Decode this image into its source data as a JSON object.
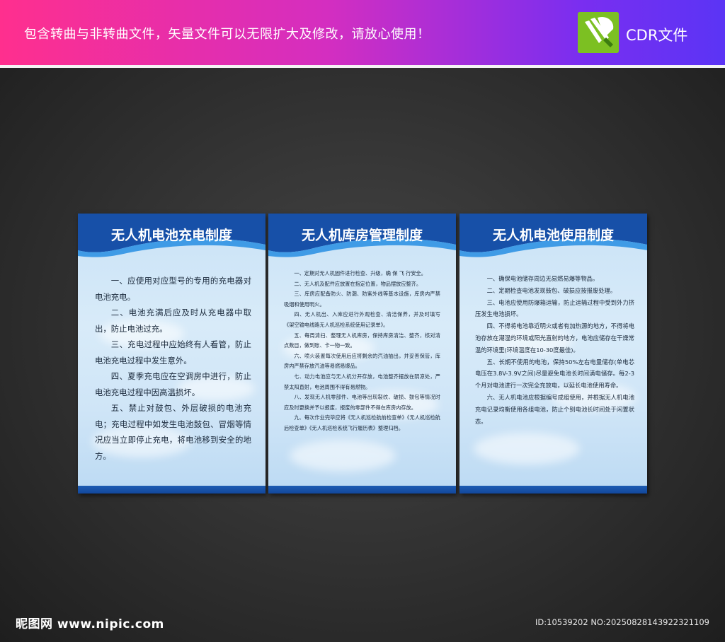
{
  "banner": {
    "text": "包含转曲与非转曲文件，矢量文件可以无限扩大及修改，请放心使用！",
    "badge_label": "CDR文件"
  },
  "panels": [
    {
      "title": "无人机电池充电制度",
      "paragraphs": [
        "一、应使用对应型号的专用的充电器对电池充电。",
        "二、电池充满后应及时从充电器中取出，防止电池过充。",
        "三、充电过程中应始终有人看管，防止电池充电过程中发生意外。",
        "四、夏季充电应在空调房中进行，防止电池充电过程中因高温损坏。",
        "五、禁止对鼓包、外层破损的电池充电；充电过程中如发生电池鼓包、冒烟等情况应当立即停止充电，将电池移到安全的地方。"
      ]
    },
    {
      "title": "无人机库房管理制度",
      "paragraphs": [
        "一、定期对无人机固件进行检查、升级，确 保 飞 行安全。",
        "二、无人机及配件应放置在指定位置，物品摆放应整齐。",
        "三、库房应配备防火、防潮、防紫外线等基本设施，库房内严禁吸烟和使用明火。",
        "四、无人机出、入库应进行外观检查、清洁保养，并及时填写《架空输电线路无人机巡检系统使用记录单》。",
        "五、每周清扫、整理无人机库房，保持库房清洁、整齐，核对清点数目，做到账、卡一物一致。",
        "六、喷火装置每次使用后应将剩余的汽油抽出，并妥善保管，库房内严禁存放汽油等易燃易爆品。",
        "七、动力电池应与无人机分开存放，电池整齐摆放在阴凉处，严禁太阳直射，电池周围不得有易燃物。",
        "八、发现无人机零部件、电池等出现裂纹、破损、鼓包等情况时应及时更换并予以报废，报废的零部件不得在库房内存放。",
        "九、每次作业完毕应将《无人机巡检航前检查单》《无人机巡检航后检查单》《无人机巡检系统飞行履历表》整理归档。"
      ]
    },
    {
      "title": "无人机电池使用制度",
      "paragraphs": [
        "一、确保电池储存周边无易燃易爆等物品。",
        "二、定期检查电池发现鼓包、破损应按报废处理。",
        "三、电池应使用防爆箱运输，防止运输过程中受到外力挤压发生电池损坏。",
        "四、不得将电池靠近明火或者有加热源的地方，不得将电池存放在潮湿的环境或阳光直射的地方，电池应储存在干燥常温的环境里(环境温度在10-30度最佳)。",
        "五、长期不使用的电池，保持50%左右电量储存(单电芯电压在3.8V-3.9V之间)尽量避免电池长时间满电储存。每2-3个月对电池进行一次完全充放电，以延长电池使用寿命。",
        "六、无人机电池应根据编号成组使用，并根据无人机电池充电记录均衡使用各组电池，防止个别电池长时间处于闲置状态。"
      ]
    }
  ],
  "footer": {
    "site": "昵图网 www.nipic.com",
    "id_text": "ID:10539202 NO:20250828143922321109"
  },
  "icons": {
    "logo": "coreldraw-balloon-icon"
  }
}
